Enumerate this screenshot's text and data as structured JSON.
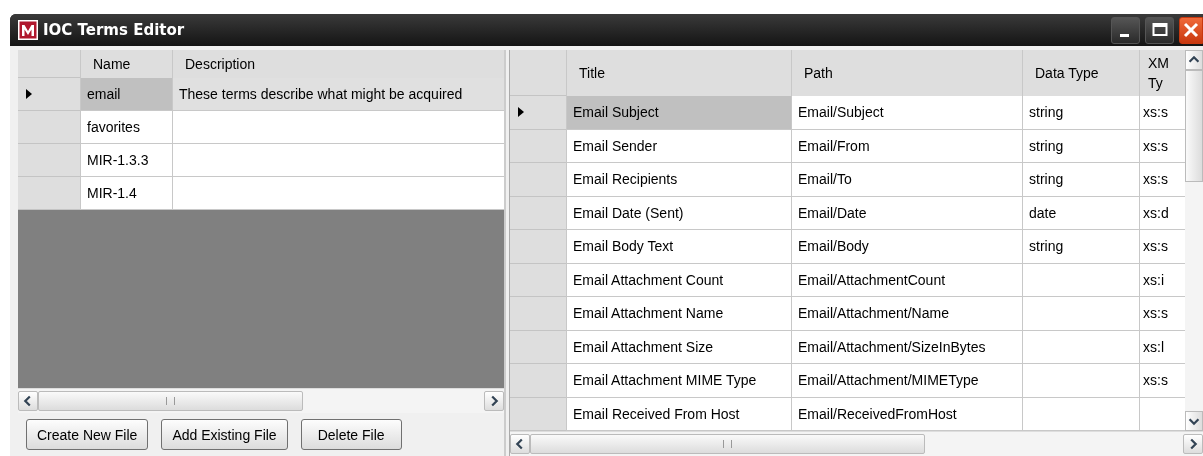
{
  "window": {
    "title": "IOC Terms Editor"
  },
  "files_table": {
    "columns": [
      "Name",
      "Description"
    ],
    "rows": [
      {
        "selected": true,
        "cells": [
          "email",
          "These terms describe what might be acquired"
        ]
      },
      {
        "selected": false,
        "cells": [
          "favorites",
          ""
        ]
      },
      {
        "selected": false,
        "cells": [
          "MIR-1.3.3",
          ""
        ]
      },
      {
        "selected": false,
        "cells": [
          "MIR-1.4",
          ""
        ]
      }
    ]
  },
  "buttons": [
    "Create New File",
    "Add Existing File",
    "Delete File"
  ],
  "terms_table": {
    "columns": [
      "Title",
      "Path",
      "Data Type",
      "XM Ty"
    ],
    "rows": [
      {
        "selected": true,
        "cells": [
          "Email Subject",
          "Email/Subject",
          "string",
          "xs:s"
        ]
      },
      {
        "selected": false,
        "cells": [
          "Email Sender",
          "Email/From",
          "string",
          "xs:s"
        ]
      },
      {
        "selected": false,
        "cells": [
          "Email Recipients",
          "Email/To",
          "string",
          "xs:s"
        ]
      },
      {
        "selected": false,
        "cells": [
          "Email Date (Sent)",
          "Email/Date",
          "date",
          "xs:d"
        ]
      },
      {
        "selected": false,
        "cells": [
          "Email Body Text",
          "Email/Body",
          "string",
          "xs:s"
        ]
      },
      {
        "selected": false,
        "cells": [
          "Email Attachment Count",
          "Email/AttachmentCount",
          "",
          "xs:i"
        ]
      },
      {
        "selected": false,
        "cells": [
          "Email Attachment Name",
          "Email/Attachment/Name",
          "",
          "xs:s"
        ]
      },
      {
        "selected": false,
        "cells": [
          "Email Attachment Size",
          "Email/Attachment/SizeInBytes",
          "",
          "xs:l"
        ]
      },
      {
        "selected": false,
        "cells": [
          "Email Attachment MIME Type",
          "Email/Attachment/MIMEType",
          "",
          "xs:s"
        ]
      },
      {
        "selected": false,
        "cells": [
          "Email Received From Host",
          "Email/ReceivedFromHost",
          "",
          ""
        ]
      }
    ]
  }
}
